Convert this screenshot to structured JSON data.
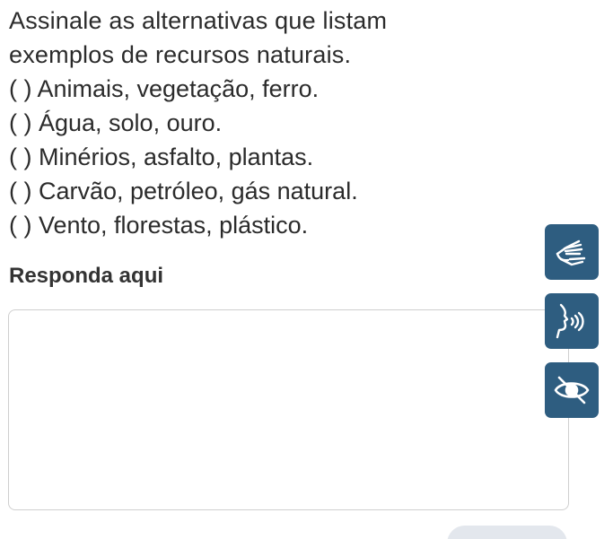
{
  "question": {
    "line1": "Assinale as alternativas que listam",
    "line2": "exemplos de recursos naturais."
  },
  "options": [
    "( ) Animais, vegetação, ferro.",
    "( ) Água, solo, ouro.",
    "( ) Minérios, asfalto, plantas.",
    "( ) Carvão, petróleo, gás natural.",
    "( ) Vento, florestas, plástico."
  ],
  "answer": {
    "label": "Responda aqui",
    "value": ""
  },
  "accessibility_buttons": [
    {
      "icon": "sign-language-hands-icon"
    },
    {
      "icon": "speaking-head-audio-icon"
    },
    {
      "icon": "eye-slash-icon"
    }
  ],
  "colors": {
    "text": "#2b2b2b",
    "accessibility_button_bg": "#2e5d80",
    "answer_border": "#cfcfcf",
    "bottom_pill": "#e3e7ed"
  }
}
